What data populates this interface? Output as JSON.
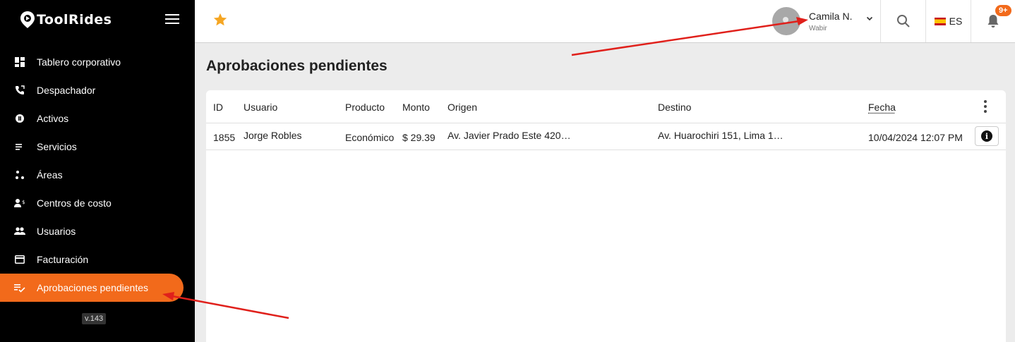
{
  "sidebar": {
    "logo": "ToolRides",
    "version": "v.143",
    "items": [
      {
        "label": "Tablero corporativo",
        "icon": "dashboard-icon"
      },
      {
        "label": "Despachador",
        "icon": "phone-icon"
      },
      {
        "label": "Activos",
        "icon": "location-dot-icon"
      },
      {
        "label": "Servicios",
        "icon": "list-icon"
      },
      {
        "label": "Áreas",
        "icon": "scatter-icon"
      },
      {
        "label": "Centros de costo",
        "icon": "people-cost-icon"
      },
      {
        "label": "Usuarios",
        "icon": "group-icon"
      },
      {
        "label": "Facturación",
        "icon": "credit-card-icon"
      },
      {
        "label": "Aprobaciones pendientes",
        "icon": "checklist-icon",
        "active": true
      }
    ]
  },
  "header": {
    "user_name": "Camila N.",
    "user_company": "Wabir",
    "language": "ES",
    "notifications": "9+"
  },
  "page": {
    "title": "Aprobaciones pendientes"
  },
  "table": {
    "columns": [
      "ID",
      "Usuario",
      "Producto",
      "Monto",
      "Origen",
      "Destino",
      "Fecha"
    ],
    "rows": [
      {
        "id": "1855",
        "usuario": "Jorge Robles",
        "producto": "Económico",
        "monto": "$ 29.39",
        "origen": "Av. Javier Prado Este 420…",
        "destino": "Av. Huarochiri 151, Lima 1…",
        "fecha": "10/04/2024 12:07 PM"
      }
    ]
  },
  "colors": {
    "accent": "#f26a1b",
    "star": "#f5a623",
    "annotation_arrow": "#e0201b"
  }
}
